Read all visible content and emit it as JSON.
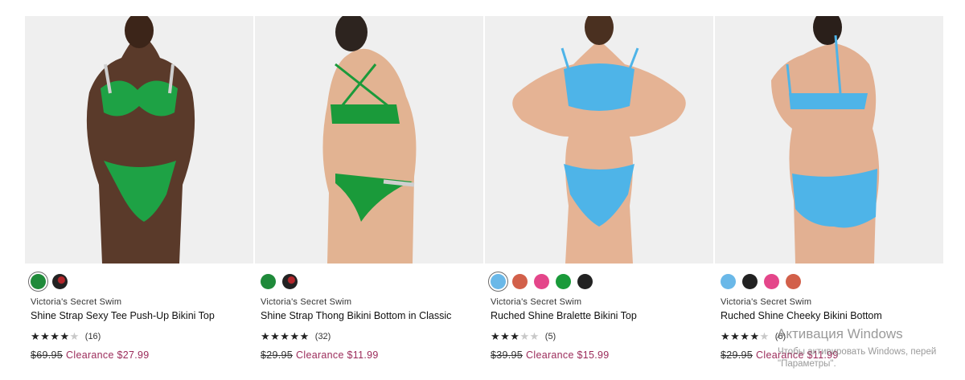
{
  "products": [
    {
      "brand": "Victoria's Secret Swim",
      "name": "Shine Strap Sexy Tee Push-Up Bikini Top",
      "stars": "★★★★",
      "stars_empty": "★",
      "rating": 4.0,
      "review_count": "(16)",
      "old_price": "$69.95",
      "sale_price": "Clearance $27.99",
      "swatches": [
        {
          "name": "green",
          "color": "#1f8a3a"
        },
        {
          "name": "black-floral",
          "color": "#222222"
        }
      ],
      "selected_swatch": 0,
      "image_name": "model-green-push-up-top"
    },
    {
      "brand": "Victoria's Secret Swim",
      "name": "Shine Strap Thong Bikini Bottom in Classic",
      "stars": "★★★★★",
      "stars_empty": "",
      "rating": 5.0,
      "review_count": "(32)",
      "old_price": "$29.95",
      "sale_price": "Clearance $11.99",
      "swatches": [
        {
          "name": "green",
          "color": "#1f8a3a"
        },
        {
          "name": "black-floral",
          "color": "#222222"
        }
      ],
      "selected_swatch": -1,
      "image_name": "model-green-thong-bottom-back"
    },
    {
      "brand": "Victoria's Secret Swim",
      "name": "Ruched Shine Bralette Bikini Top",
      "stars": "★★★",
      "stars_empty": "★★",
      "rating": 3.5,
      "review_count": "(5)",
      "old_price": "$39.95",
      "sale_price": "Clearance $15.99",
      "swatches": [
        {
          "name": "sky-blue",
          "color": "#6ab8e8"
        },
        {
          "name": "rust",
          "color": "#d2604a"
        },
        {
          "name": "pink",
          "color": "#e4468a"
        },
        {
          "name": "green",
          "color": "#1a9a3a"
        },
        {
          "name": "black",
          "color": "#222222"
        }
      ],
      "selected_swatch": 0,
      "image_name": "model-blue-bralette-top"
    },
    {
      "brand": "Victoria's Secret Swim",
      "name": "Ruched Shine Cheeky Bikini Bottom",
      "stars": "★★★★",
      "stars_empty": "★",
      "rating": 4.0,
      "review_count": "(6)",
      "old_price": "$29.95",
      "sale_price": "Clearance $11.99",
      "swatches": [
        {
          "name": "sky-blue",
          "color": "#6ab8e8"
        },
        {
          "name": "black",
          "color": "#222222"
        },
        {
          "name": "pink",
          "color": "#e4468a"
        },
        {
          "name": "rust",
          "color": "#d2604a"
        }
      ],
      "selected_swatch": -1,
      "image_name": "model-blue-cheeky-bottom-back"
    }
  ],
  "os_watermark": {
    "title": "Активация Windows",
    "line1": "Чтобы активировать Windows, перей",
    "line2": "\"Параметры\"."
  },
  "colors": {
    "clearance": "#9b2b5a",
    "photo_bg": "#efefef"
  }
}
